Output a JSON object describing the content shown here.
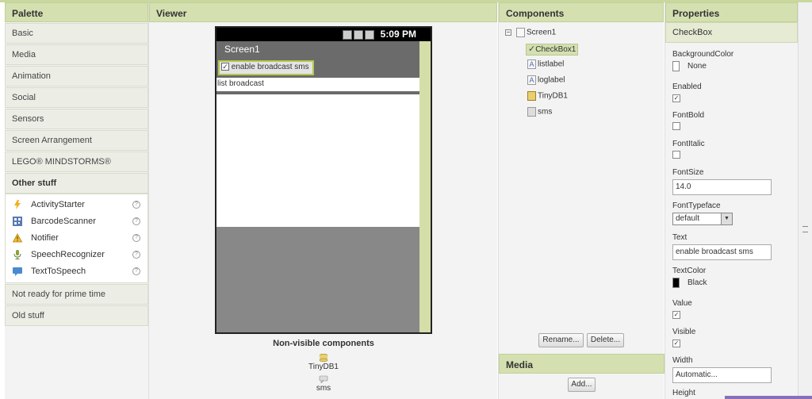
{
  "palette": {
    "title": "Palette",
    "categories": [
      "Basic",
      "Media",
      "Animation",
      "Social",
      "Sensors",
      "Screen Arrangement",
      "LEGO® MINDSTORMS®"
    ],
    "open_category": "Other stuff",
    "items": [
      {
        "label": "ActivityStarter",
        "icon": "lightning-icon"
      },
      {
        "label": "BarcodeScanner",
        "icon": "barcode-icon"
      },
      {
        "label": "Notifier",
        "icon": "warning-icon"
      },
      {
        "label": "SpeechRecognizer",
        "icon": "microphone-icon"
      },
      {
        "label": "TextToSpeech",
        "icon": "speech-bubble-icon"
      }
    ],
    "help_glyph": "?",
    "after_categories": [
      "Not ready for prime time",
      "Old stuff"
    ]
  },
  "viewer": {
    "title": "Viewer",
    "status_time": "5:09 PM",
    "screen_title": "Screen1",
    "checkbox_text": "enable broadcast sms",
    "list_label_text": "list broadcast",
    "nonvisible_title": "Non-visible components",
    "nonvisible": [
      "TinyDB1",
      "sms"
    ]
  },
  "components": {
    "title": "Components",
    "root": "Screen1",
    "children": [
      "CheckBox1",
      "listlabel",
      "loglabel",
      "TinyDB1",
      "sms"
    ],
    "rename_label": "Rename...",
    "delete_label": "Delete...",
    "media_title": "Media",
    "add_label": "Add..."
  },
  "properties": {
    "title": "Properties",
    "selected": "CheckBox",
    "background_color_label": "BackgroundColor",
    "background_color_value": "None",
    "enabled_label": "Enabled",
    "fontbold_label": "FontBold",
    "fontitalic_label": "FontItalic",
    "fontsize_label": "FontSize",
    "fontsize_value": "14.0",
    "fonttypeface_label": "FontTypeface",
    "fonttypeface_value": "default",
    "text_label": "Text",
    "text_value": "enable broadcast sms",
    "textcolor_label": "TextColor",
    "textcolor_value": "Black",
    "value_label": "Value",
    "visible_label": "Visible",
    "width_label": "Width",
    "width_value": "Automatic...",
    "height_label": "Height"
  },
  "colors": {
    "header_bg": "#d4e0b0",
    "selection_border": "#b4c94f",
    "phone_gray": "#6b6b6b"
  }
}
